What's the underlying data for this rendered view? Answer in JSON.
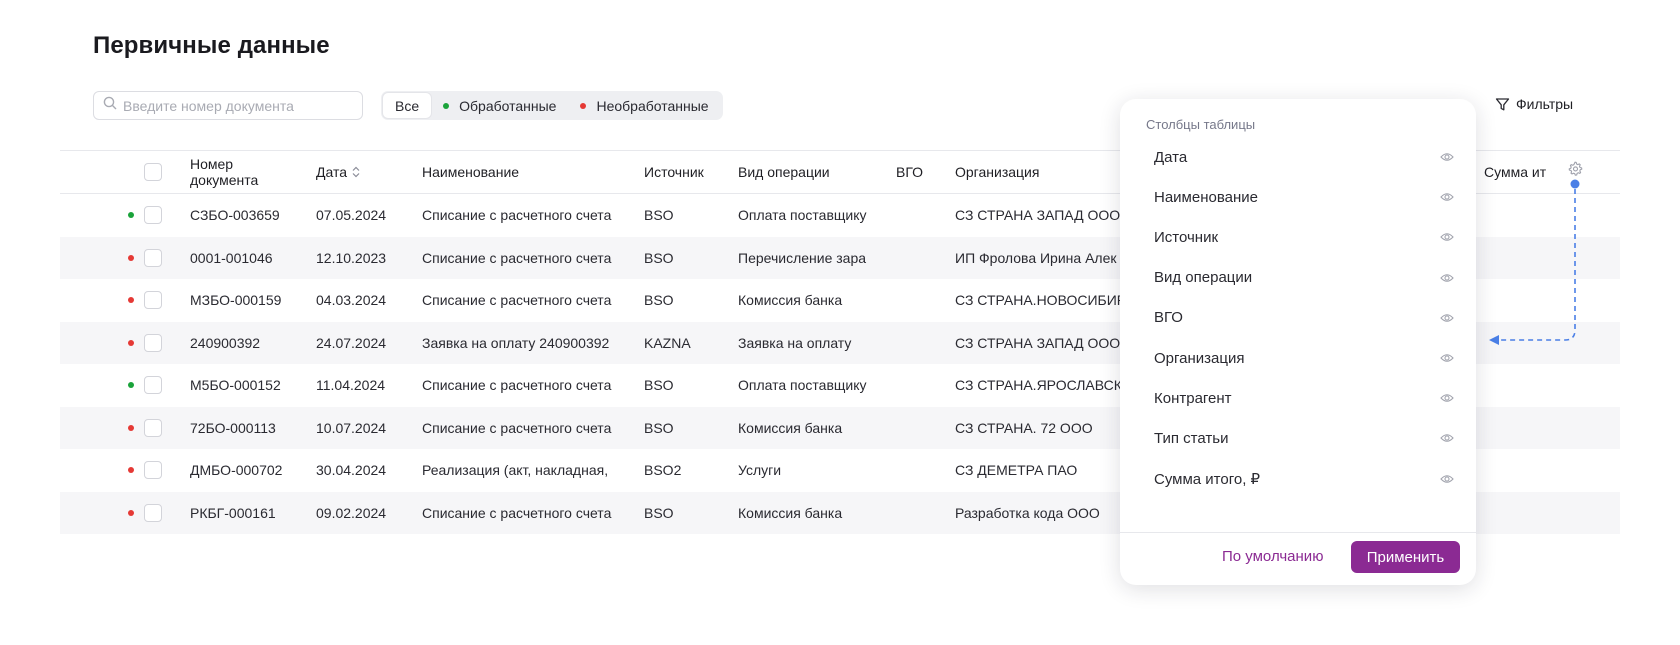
{
  "page": {
    "title": "Первичные данные"
  },
  "search": {
    "placeholder": "Введите номер документа",
    "icon": "search-icon"
  },
  "segments": [
    {
      "label": "Все",
      "active": true,
      "dot": null
    },
    {
      "label": "Обработанные",
      "active": false,
      "dot": "#1aa33a"
    },
    {
      "label": "Необработанные",
      "active": false,
      "dot": "#e53935"
    }
  ],
  "filters": {
    "label": "Фильтры",
    "icon": "filter-icon"
  },
  "table": {
    "headers": {
      "number_l1": "Номер",
      "number_l2": "документа",
      "date": "Дата",
      "name": "Наименование",
      "source": "Источник",
      "operation": "Вид операции",
      "vgo": "ВГО",
      "org": "Организация",
      "sum": "Сумма ит"
    },
    "rows": [
      {
        "status": "processed",
        "number": "СЗБО-003659",
        "date": "07.05.2024",
        "name": "Списание с расчетного счета",
        "source": "BSO",
        "operation": "Оплата поставщику",
        "vgo": "",
        "org": "СЗ СТРАНА ЗАПАД ООО"
      },
      {
        "status": "unprocessed",
        "number": "0001-001046",
        "date": "12.10.2023",
        "name": "Списание с расчетного счета",
        "source": "BSO",
        "operation": "Перечисление зара",
        "vgo": "",
        "org": "ИП Фролова Ирина Алек"
      },
      {
        "status": "unprocessed",
        "number": "МЗБО-000159",
        "date": "04.03.2024",
        "name": "Списание с расчетного счета",
        "source": "BSO",
        "operation": "Комиссия банка",
        "vgo": "",
        "org": "СЗ СТРАНА.НОВОСИБИР"
      },
      {
        "status": "unprocessed",
        "number": "240900392",
        "date": "24.07.2024",
        "name": "Заявка на оплату 240900392",
        "source": "KAZNA",
        "operation": "Заявка на оплату",
        "vgo": "",
        "org": "СЗ СТРАНА ЗАПАД ООО"
      },
      {
        "status": "processed",
        "number": "М5БО-000152",
        "date": "11.04.2024",
        "name": "Списание с расчетного счета",
        "source": "BSO",
        "operation": "Оплата поставщику",
        "vgo": "",
        "org": "СЗ СТРАНА.ЯРОСЛАВСК"
      },
      {
        "status": "unprocessed",
        "number": "72БО-000113",
        "date": "10.07.2024",
        "name": "Списание с расчетного счета",
        "source": "BSO",
        "operation": "Комиссия банка",
        "vgo": "",
        "org": "СЗ СТРАНА. 72 ООО"
      },
      {
        "status": "unprocessed",
        "number": "ДМБО-000702",
        "date": "30.04.2024",
        "name": "Реализация (акт, накладная,",
        "source": "BSO2",
        "operation": "Услуги",
        "vgo": "",
        "org": "СЗ ДЕМЕТРА ПАО"
      },
      {
        "status": "unprocessed",
        "number": "РКБГ-000161",
        "date": "09.02.2024",
        "name": "Списание с расчетного счета",
        "source": "BSO",
        "operation": "Комиссия банка",
        "vgo": "",
        "org": "Разработка кода ООО"
      }
    ]
  },
  "column_settings": {
    "title": "Столбцы таблицы",
    "items": [
      {
        "label": "Дата",
        "icon": "eye-icon"
      },
      {
        "label": "Наименование",
        "icon": "eye-icon"
      },
      {
        "label": "Источник",
        "icon": "eye-icon"
      },
      {
        "label": "Вид операции",
        "icon": "eye-icon"
      },
      {
        "label": "ВГО",
        "icon": "eye-icon"
      },
      {
        "label": "Организация",
        "icon": "eye-icon"
      },
      {
        "label": "Контрагент",
        "icon": "eye-icon"
      },
      {
        "label": "Тип статьи",
        "icon": "eye-icon"
      },
      {
        "label": "Сумма итого, ₽",
        "icon": "eye-icon"
      }
    ],
    "default_label": "По умолчанию",
    "apply_label": "Применить"
  },
  "colors": {
    "accent": "#8b2a93",
    "processed": "#1aa33a",
    "unprocessed": "#e53935",
    "connector": "#4a7fe6"
  }
}
